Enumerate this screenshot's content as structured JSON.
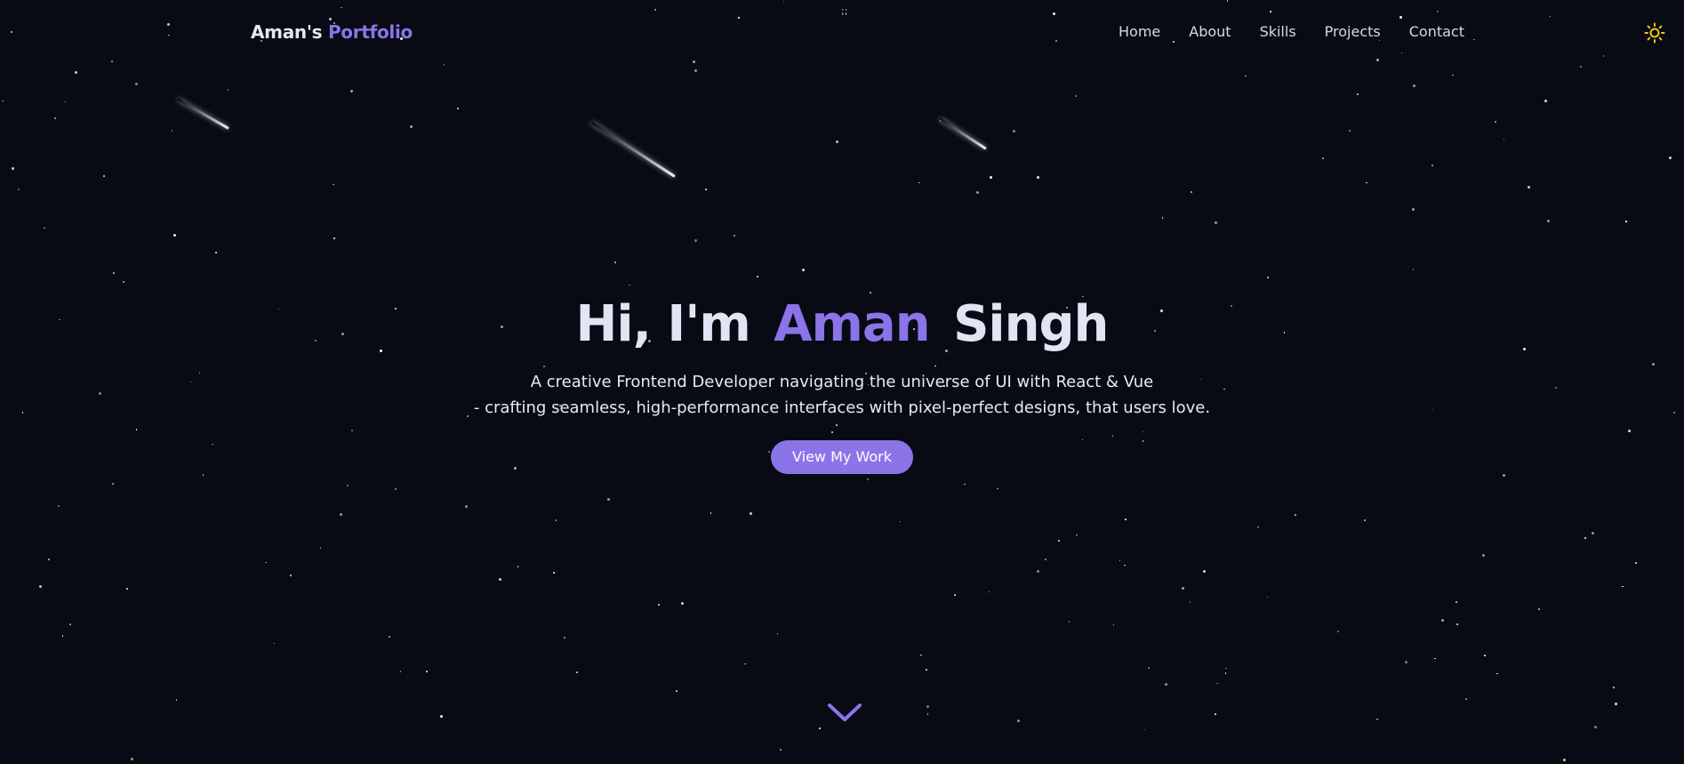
{
  "header": {
    "brand_first": "Aman's",
    "brand_accent": "Portfolio",
    "nav": [
      {
        "label": "Home"
      },
      {
        "label": "About"
      },
      {
        "label": "Skills"
      },
      {
        "label": "Projects"
      },
      {
        "label": "Contact"
      }
    ],
    "theme_toggle_icon": "sun-icon"
  },
  "top_hint": ";;",
  "hero": {
    "greeting": "Hi, I'm",
    "first_name": "Aman",
    "last_name": "Singh",
    "tagline_line1": "A creative Frontend Developer navigating the universe of UI with React & Vue",
    "tagline_line2": "- crafting seamless, high-performance interfaces with pixel-perfect designs, that users love.",
    "cta_label": "View My Work"
  },
  "scroll_icon": "chevron-down-icon",
  "colors": {
    "background": "#080b14",
    "accent": "#8b74e8",
    "text": "#e4e7f0",
    "sun": "#f5c518"
  }
}
